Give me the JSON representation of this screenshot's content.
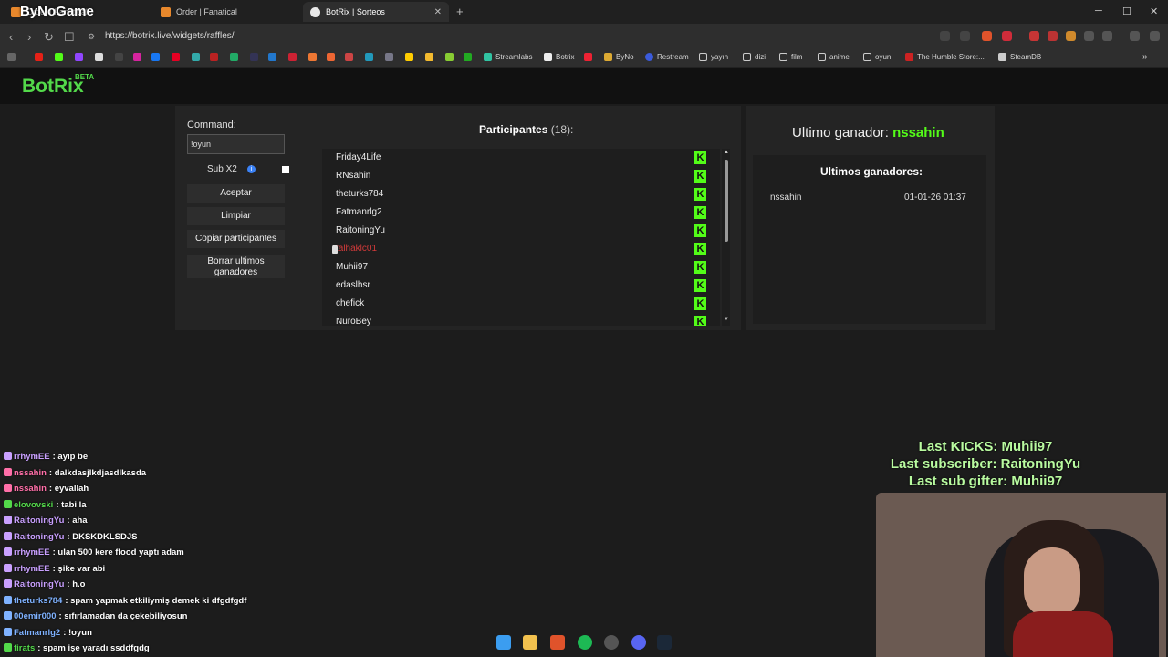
{
  "browser": {
    "tabs": [
      {
        "title": "Order | Fanatical"
      },
      {
        "title": "Order | Fanatical"
      },
      {
        "title": "BotRix | Sorteos"
      }
    ],
    "url": "https://botrix.live/widgets/raffles/",
    "bookmarks": [
      "Streamlabs",
      "Botrix",
      "ByNo",
      "Restream",
      "yayın",
      "dizi",
      "film",
      "anime",
      "oyun",
      "The Humble Store:...",
      "SteamDB"
    ],
    "overlay_brand": "ByNoGame"
  },
  "app": {
    "logo": "BotRix",
    "beta": "BETA"
  },
  "raffle": {
    "command_label": "Command:",
    "command_value": "!oyun",
    "sub_label": "Sub X2",
    "buttons": {
      "accept": "Aceptar",
      "clear": "Limpiar",
      "copy": "Copiar participantes",
      "delete_winners": "Borrar ultimos ganadores"
    },
    "participants_title": "Participantes",
    "participants_count": "(18):",
    "participants": [
      "Friday4Life",
      "RNsahin",
      "theturks784",
      "Fatmanrlg2",
      "RaitoningYu",
      "talhaklc01",
      "Muhii97",
      "edaslhsr",
      "chefick",
      "NuroBey"
    ],
    "highlighted_participant_index": 5
  },
  "winners": {
    "last_winner_label": "Ultimo ganador:",
    "last_winner_name": "nssahin",
    "history_title": "Ultimos ganadores:",
    "history": [
      {
        "name": "nssahin",
        "date": "01-01-26 01:37"
      }
    ]
  },
  "chat": [
    {
      "user": "rrhymEE",
      "msg": ": ayıp be",
      "color": "#c9a0ff"
    },
    {
      "user": "nssahin",
      "msg": ": dalkdasjlkdjasdlkasda",
      "color": "#ff6fa8"
    },
    {
      "user": "nssahin",
      "msg": ": eyvallah",
      "color": "#ff6fa8"
    },
    {
      "user": "elovovski",
      "msg": ": tabi la",
      "color": "#53d94a"
    },
    {
      "user": "RaitoningYu",
      "msg": ": aha",
      "color": "#c9a0ff"
    },
    {
      "user": "RaitoningYu",
      "msg": ": DKSKDKLSDJS",
      "color": "#c9a0ff"
    },
    {
      "user": "rrhymEE",
      "msg": ": ulan 500 kere flood yaptı adam",
      "color": "#c9a0ff"
    },
    {
      "user": "rrhymEE",
      "msg": ": şike var abi",
      "color": "#c9a0ff"
    },
    {
      "user": "RaitoningYu",
      "msg": ": h.o",
      "color": "#c9a0ff"
    },
    {
      "user": "theturks784",
      "msg": ": spam yapmak etkiliymiş demek ki dfgdfgdf",
      "color": "#7fb2ff"
    },
    {
      "user": "00emir000",
      "msg": ": sıfırlamadan da çekebiliyosun",
      "color": "#7fb2ff"
    },
    {
      "user": "Fatmanrlg2",
      "msg": ": !oyun",
      "color": "#7fb2ff"
    },
    {
      "user": "firats",
      "msg": ": spam işe yaradı ssddfgdg",
      "color": "#53d94a"
    }
  ],
  "stream_overlay": {
    "last_kicks": "Last KICKS: Muhii97",
    "last_subscriber": "Last subscriber: RaitoningYu",
    "last_sub_gifter": "Last sub gifter: Muhii97"
  },
  "colors": {
    "kick_green": "#53fc18",
    "botrix_green": "#53d94a"
  }
}
